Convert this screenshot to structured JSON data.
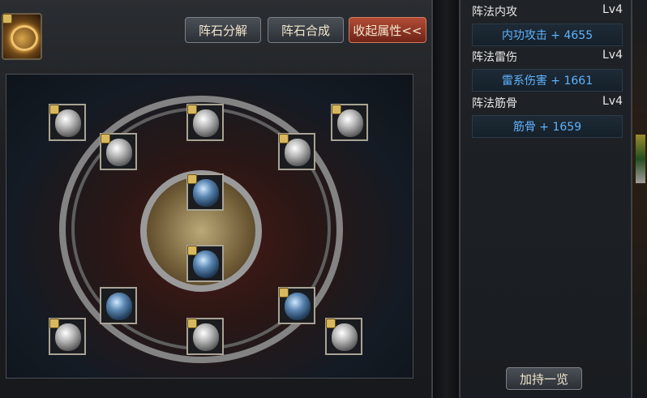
{
  "toolbar": {
    "decompose_label": "阵石分解",
    "combine_label": "阵石合成",
    "collapse_label": "收起属性<<"
  },
  "attributes": [
    {
      "name": "阵法内攻",
      "level": "Lv4",
      "value": "内功攻击 + 4655"
    },
    {
      "name": "阵法雷伤",
      "level": "Lv4",
      "value": "雷系伤害 + 1661"
    },
    {
      "name": "阵法筋骨",
      "level": "Lv4",
      "value": "筋骨 + 1659"
    }
  ],
  "footer": {
    "bonus_overview_label": "加持一览"
  },
  "formation": {
    "slots": [
      {
        "style": "silver",
        "locked": true
      },
      {
        "style": "silver",
        "locked": true
      },
      {
        "style": "silver",
        "locked": true
      },
      {
        "style": "silver",
        "locked": true
      },
      {
        "style": "silver",
        "locked": true
      },
      {
        "style": "blue",
        "locked": true
      },
      {
        "style": "blue",
        "locked": true
      },
      {
        "style": "blue",
        "locked": false
      },
      {
        "style": "blue",
        "locked": true
      },
      {
        "style": "silver",
        "locked": true
      },
      {
        "style": "silver",
        "locked": true
      },
      {
        "style": "silver",
        "locked": true
      }
    ]
  },
  "colors": {
    "accent_red": "#b24c36",
    "attribute_value": "#5fb3ff"
  }
}
